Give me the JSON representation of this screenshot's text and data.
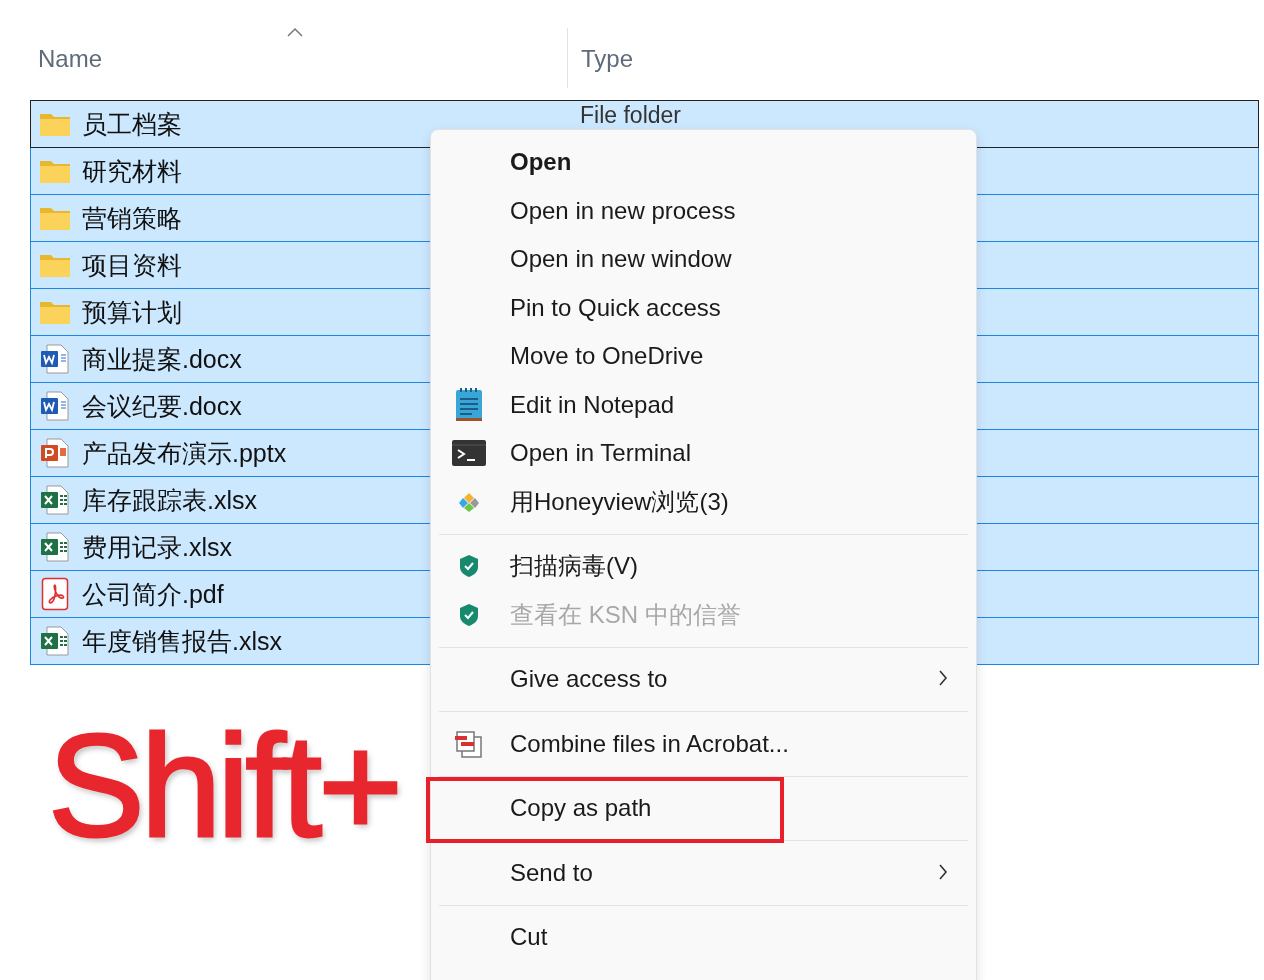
{
  "columns": [
    {
      "label": "Name",
      "sorted": true
    },
    {
      "label": "Type",
      "sorted": false
    }
  ],
  "rows": [
    {
      "name": "员工档案",
      "kind": "folder",
      "type": "File folder",
      "selected": true,
      "focused": true
    },
    {
      "name": "研究材料",
      "kind": "folder",
      "selected": true,
      "focused": false
    },
    {
      "name": "营销策略",
      "kind": "folder",
      "selected": true,
      "focused": false
    },
    {
      "name": "项目资料",
      "kind": "folder",
      "selected": true,
      "focused": false
    },
    {
      "name": "预算计划",
      "kind": "folder",
      "selected": true,
      "focused": false
    },
    {
      "name": "商业提案.docx",
      "kind": "word",
      "selected": true,
      "focused": false
    },
    {
      "name": "会议纪要.docx",
      "kind": "word",
      "selected": true,
      "focused": false
    },
    {
      "name": "产品发布演示.pptx",
      "kind": "powerpoint",
      "selected": true,
      "focused": false
    },
    {
      "name": "库存跟踪表.xlsx",
      "kind": "excel",
      "selected": true,
      "focused": false
    },
    {
      "name": "费用记录.xlsx",
      "kind": "excel",
      "selected": true,
      "focused": false
    },
    {
      "name": "公司简介.pdf",
      "kind": "pdf",
      "selected": true,
      "focused": false
    },
    {
      "name": "年度销售报告.xlsx",
      "kind": "excel",
      "selected": true,
      "focused": false
    }
  ],
  "context_menu": {
    "items": [
      {
        "kind": "plain",
        "label": "Open",
        "default": true,
        "disabled": false,
        "submenu": false,
        "marked": false
      },
      {
        "kind": "plain",
        "label": "Open in new process",
        "default": false,
        "disabled": false,
        "submenu": false,
        "marked": false
      },
      {
        "kind": "plain",
        "label": "Open in new window",
        "default": false,
        "disabled": false,
        "submenu": false,
        "marked": false
      },
      {
        "kind": "plain",
        "label": "Pin to Quick access",
        "default": false,
        "disabled": false,
        "submenu": false,
        "marked": false
      },
      {
        "kind": "plain",
        "label": "Move to OneDrive",
        "default": false,
        "disabled": false,
        "submenu": false,
        "marked": false
      },
      {
        "kind": "notepad",
        "label": "Edit in Notepad",
        "default": false,
        "disabled": false,
        "submenu": false,
        "marked": false
      },
      {
        "kind": "terminal",
        "label": "Open in Terminal",
        "default": false,
        "disabled": false,
        "submenu": false,
        "marked": false
      },
      {
        "kind": "viewer",
        "label": "用Honeyview浏览(3)",
        "default": false,
        "disabled": false,
        "submenu": false,
        "marked": false
      },
      {
        "kind": "separator"
      },
      {
        "kind": "shield",
        "label": "扫描病毒(V)",
        "default": false,
        "disabled": false,
        "submenu": false,
        "marked": false
      },
      {
        "kind": "shield",
        "label": "查看在 KSN 中的信誉",
        "default": false,
        "disabled": true,
        "submenu": false,
        "marked": false
      },
      {
        "kind": "separator"
      },
      {
        "kind": "plain",
        "label": "Give access to",
        "default": false,
        "disabled": false,
        "submenu": true,
        "marked": false
      },
      {
        "kind": "separator"
      },
      {
        "kind": "acrobat",
        "label": "Combine files in Acrobat...",
        "default": false,
        "disabled": false,
        "submenu": false,
        "marked": false
      },
      {
        "kind": "separator"
      },
      {
        "kind": "plain",
        "label": "Copy as path",
        "default": false,
        "disabled": false,
        "submenu": false,
        "marked": true
      },
      {
        "kind": "separator"
      },
      {
        "kind": "plain",
        "label": "Send to",
        "default": false,
        "disabled": false,
        "submenu": true,
        "marked": false
      },
      {
        "kind": "separator"
      },
      {
        "kind": "plain",
        "label": "Cut",
        "default": false,
        "disabled": false,
        "submenu": false,
        "marked": false
      }
    ]
  },
  "annotation": {
    "text": "Shift+"
  }
}
